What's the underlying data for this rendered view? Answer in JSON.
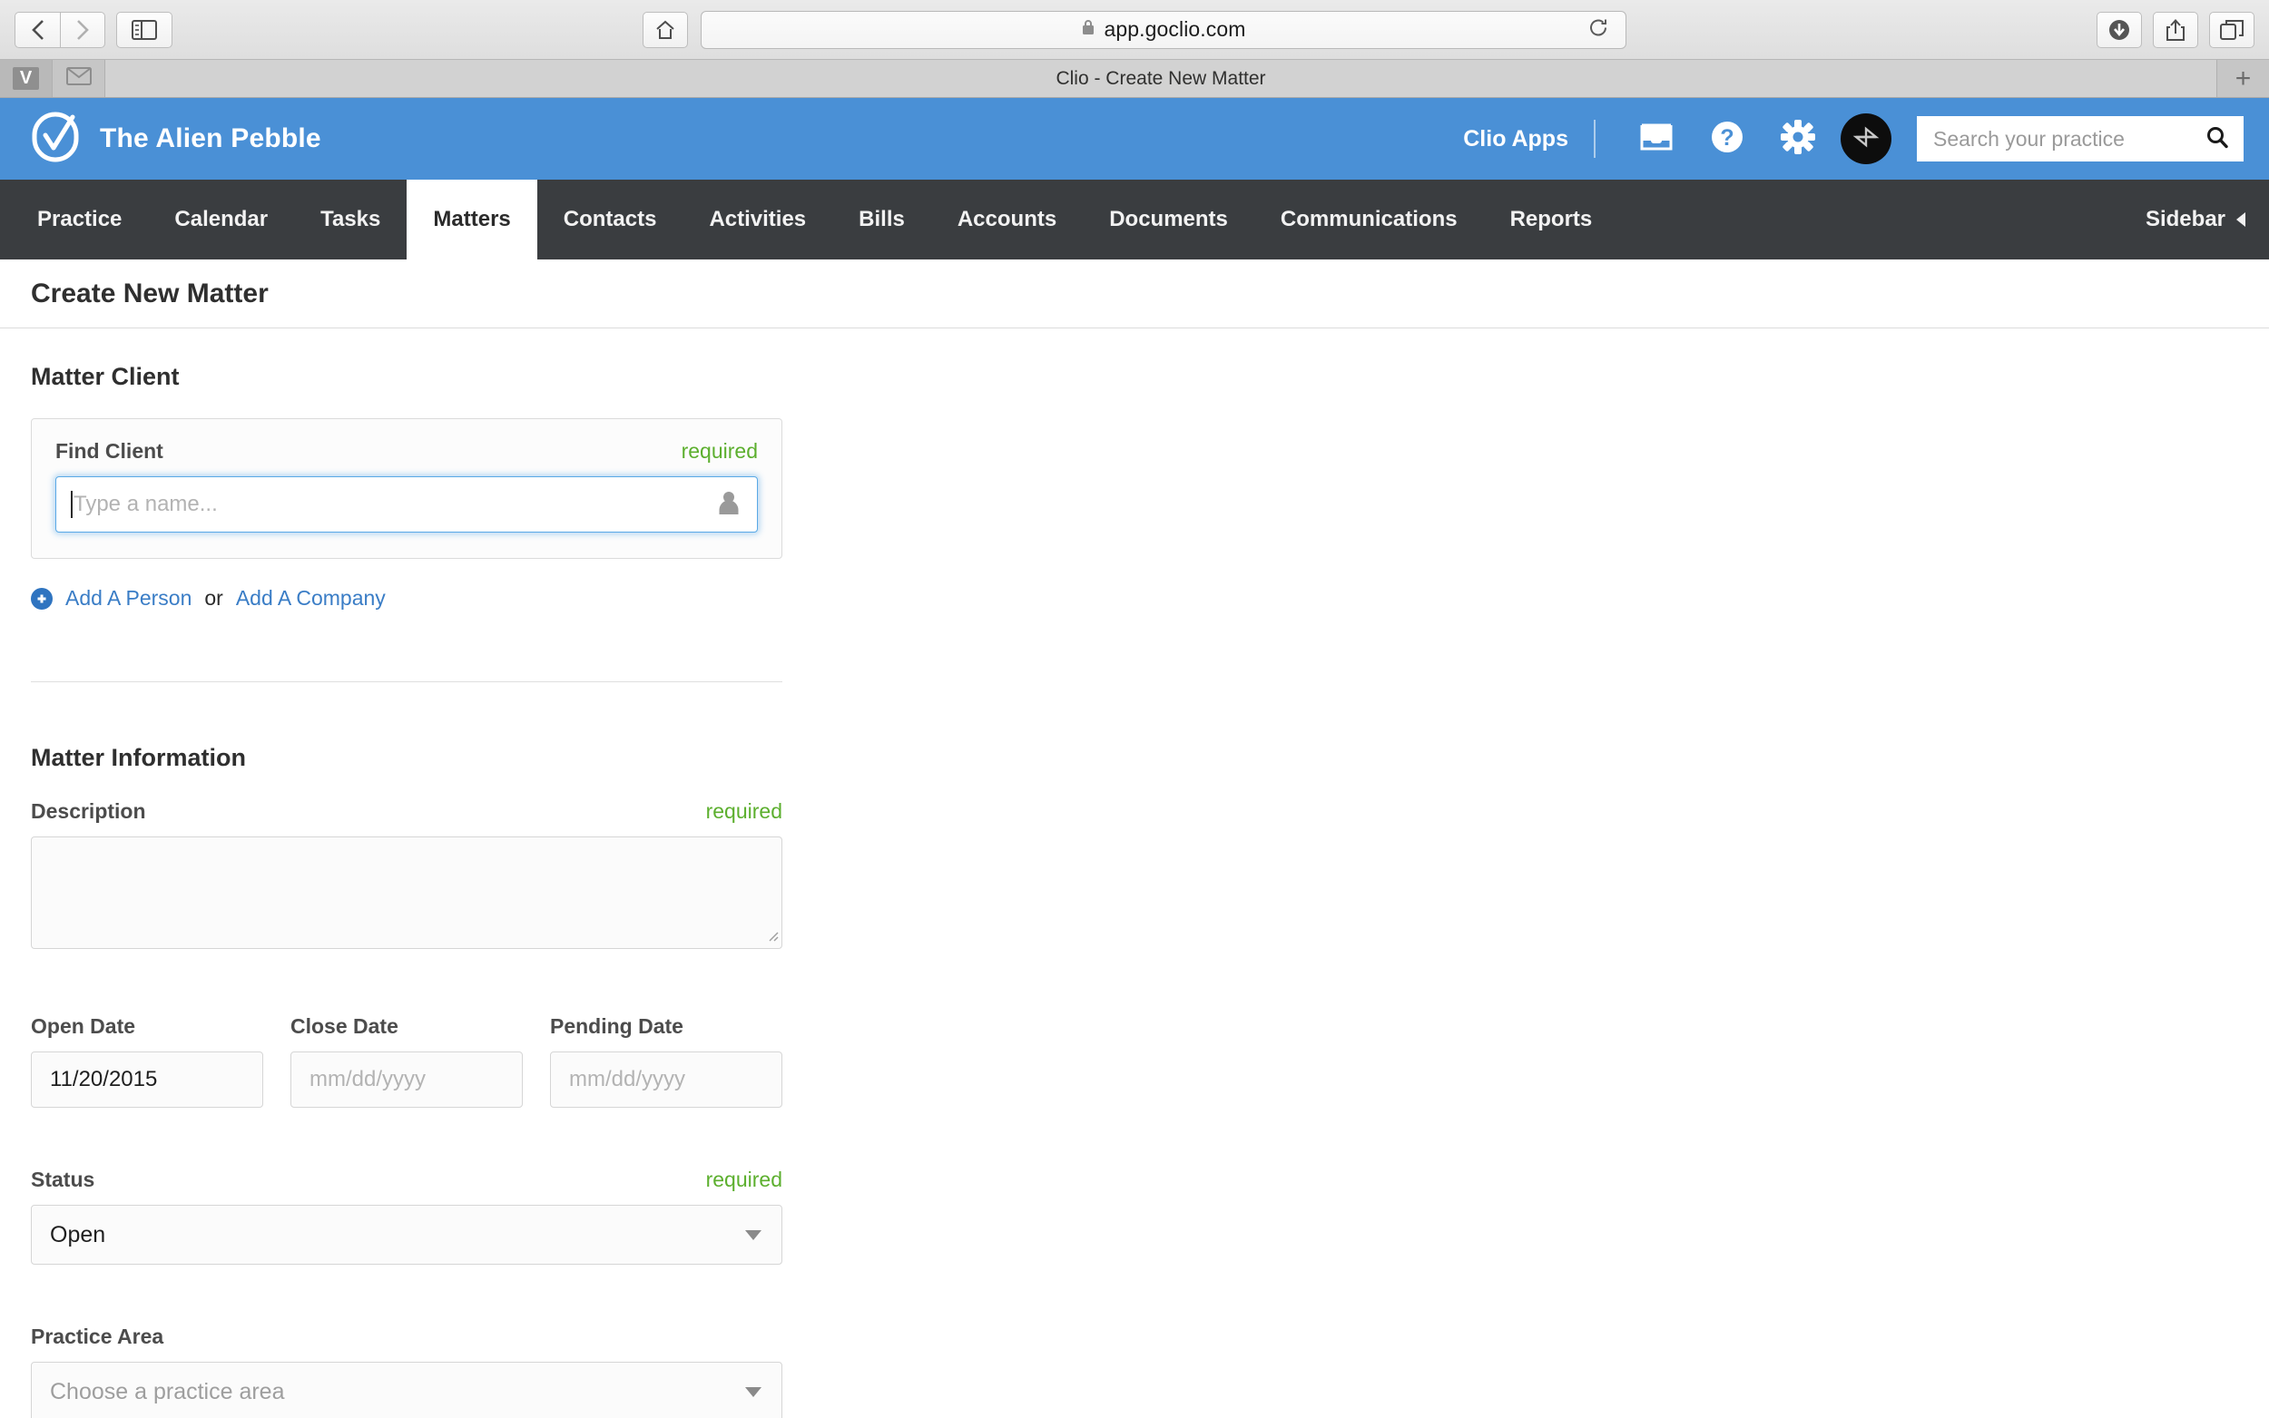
{
  "browser": {
    "back_icon": "chevron-left-icon",
    "forward_icon": "chevron-right-icon",
    "sidebar_icon": "sidebar-toggle-icon",
    "home_icon": "home-icon",
    "url": "app.goclio.com",
    "lock_icon": "lock-icon",
    "reload_icon": "reload-icon",
    "downloads_icon": "downloads-icon",
    "share_icon": "share-icon",
    "tabs_overview_icon": "tabs-overview-icon",
    "tab_title": "Clio - Create New Matter",
    "mini_tab_1_label": "V",
    "mini_tab_2_icon": "mail-icon",
    "new_tab_label": "+"
  },
  "header": {
    "logo_icon": "clio-check-logo-icon",
    "brand": "The Alien Pebble",
    "clio_apps": "Clio Apps",
    "inbox_icon": "inbox-icon",
    "help_icon": "help-icon",
    "settings_icon": "gear-icon",
    "avatar_icon": "user-avatar-icon",
    "search_placeholder": "Search your practice",
    "search_icon": "search-icon",
    "brand_color": "#4a90d6"
  },
  "nav": {
    "items": [
      {
        "label": "Practice",
        "active": false
      },
      {
        "label": "Calendar",
        "active": false
      },
      {
        "label": "Tasks",
        "active": false
      },
      {
        "label": "Matters",
        "active": true
      },
      {
        "label": "Contacts",
        "active": false
      },
      {
        "label": "Activities",
        "active": false
      },
      {
        "label": "Bills",
        "active": false
      },
      {
        "label": "Accounts",
        "active": false
      },
      {
        "label": "Documents",
        "active": false
      },
      {
        "label": "Communications",
        "active": false
      },
      {
        "label": "Reports",
        "active": false
      }
    ],
    "sidebar_label": "Sidebar",
    "sidebar_arrow_icon": "triangle-left-icon",
    "bar_color": "#3a3d40"
  },
  "page": {
    "title": "Create New Matter"
  },
  "matter_client": {
    "section_title": "Matter Client",
    "find_client_label": "Find Client",
    "required_text": "required",
    "input_placeholder": "Type a name...",
    "input_value": "",
    "person_icon": "person-icon",
    "plus_icon": "plus-circle-icon",
    "add_person_link": "Add A Person",
    "or_text": "or",
    "add_company_link": "Add A Company",
    "required_color": "#5caf2e",
    "link_color": "#3a7dc6"
  },
  "matter_information": {
    "section_title": "Matter Information",
    "description_label": "Description",
    "description_required": "required",
    "description_value": "",
    "dates": [
      {
        "label": "Open Date",
        "value": "11/20/2015",
        "placeholder": "mm/dd/yyyy"
      },
      {
        "label": "Close Date",
        "value": "",
        "placeholder": "mm/dd/yyyy"
      },
      {
        "label": "Pending Date",
        "value": "",
        "placeholder": "mm/dd/yyyy"
      }
    ],
    "status_label": "Status",
    "status_required": "required",
    "status_value": "Open",
    "practice_area_label": "Practice Area",
    "practice_area_placeholder": "Choose a practice area",
    "chevron_icon": "chevron-down-icon"
  }
}
